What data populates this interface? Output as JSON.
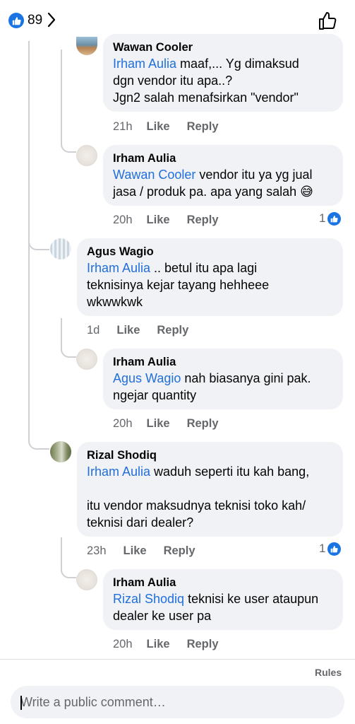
{
  "header": {
    "reaction_count": "89",
    "colors": {
      "like_blue": "#1b74e4",
      "mention_blue": "#216fdb",
      "bubble_bg": "#f0f2f5",
      "meta_gray": "#65676b"
    }
  },
  "comments": [
    {
      "author": "Wawan Cooler",
      "mention": "Irham Aulia",
      "text": " maaf,... Yg dimaksud\ndgn vendor itu apa..?\nJgn2 salah menafsirkan \"vendor\"",
      "time": "21h",
      "like": "Like",
      "reply": "Reply",
      "reactions": ""
    },
    {
      "author": "Irham Aulia",
      "mention": "Wawan Cooler",
      "text": " vendor itu ya yg jual\njasa / produk pa. apa yang salah 😅",
      "time": "20h",
      "like": "Like",
      "reply": "Reply",
      "reactions": "1"
    },
    {
      "author": "Agus Wagio",
      "mention": "Irham Aulia",
      "text": " .. betul itu apa lagi\nteknisinya kejar tayang hehheee\nwkwwkwk",
      "time": "1d",
      "like": "Like",
      "reply": "Reply",
      "reactions": ""
    },
    {
      "author": "Irham Aulia",
      "mention": "Agus Wagio",
      "text": " nah biasanya gini pak.\nngejar quantity",
      "time": "20h",
      "like": "Like",
      "reply": "Reply",
      "reactions": ""
    },
    {
      "author": "Rizal Shodiq",
      "mention": "Irham Aulia",
      "text": " waduh seperti itu kah bang,\n\nitu vendor maksudnya teknisi toko kah/\nteknisi dari dealer?",
      "time": "23h",
      "like": "Like",
      "reply": "Reply",
      "reactions": "1"
    },
    {
      "author": "Irham Aulia",
      "mention": "Rizal Shodiq",
      "text": " teknisi ke user ataupun\ndealer ke user pa",
      "time": "20h",
      "like": "Like",
      "reply": "Reply",
      "reactions": ""
    }
  ],
  "footer": {
    "rules_label": "Rules",
    "composer_placeholder": "Write a public comment…"
  }
}
